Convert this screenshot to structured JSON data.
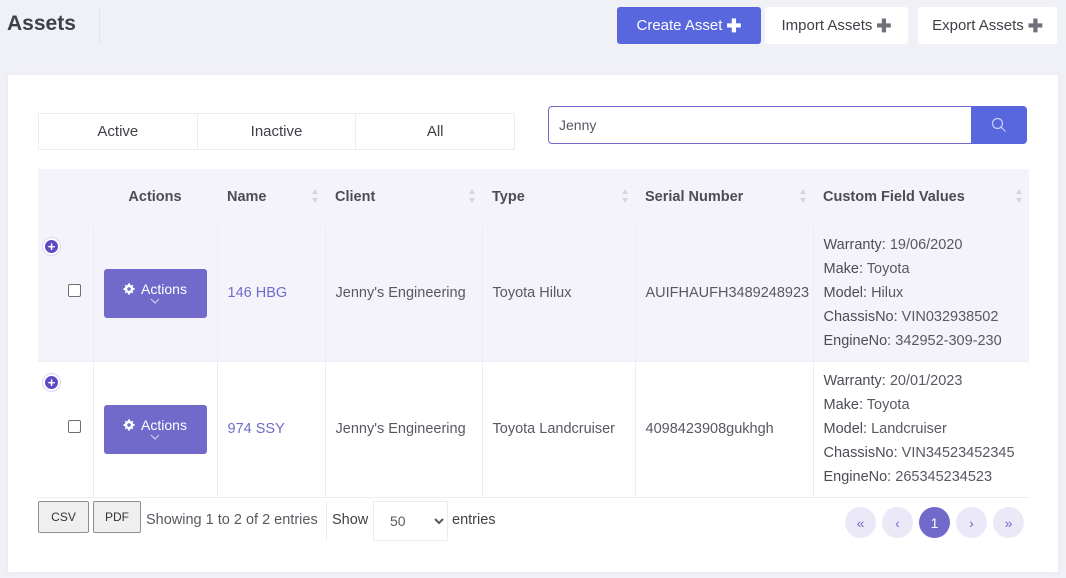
{
  "header": {
    "title": "Assets",
    "buttons": {
      "create": "Create Asset",
      "import": "Import Assets",
      "export": "Export Assets"
    }
  },
  "filters": {
    "tabs": [
      {
        "label": "Active"
      },
      {
        "label": "Inactive"
      },
      {
        "label": "All"
      }
    ]
  },
  "search": {
    "value": "Jenny",
    "icon": "search-icon"
  },
  "table": {
    "columns": [
      "",
      "Actions",
      "Name",
      "Client",
      "Type",
      "Serial Number",
      "Custom Field Values"
    ],
    "actions_label": "Actions",
    "rows": [
      {
        "name": "146 HBG",
        "client": "Jenny's Engineering",
        "type": "Toyota Hilux",
        "serial": "AUIFHAUFH3489248923",
        "custom_fields": [
          {
            "label": "Warranty:",
            "value": "19/06/2020"
          },
          {
            "label": "Make:",
            "value": "Toyota"
          },
          {
            "label": "Model:",
            "value": "Hilux"
          },
          {
            "label": "ChassisNo:",
            "value": "VIN032938502"
          },
          {
            "label": "EngineNo:",
            "value": "342952-309-230"
          }
        ]
      },
      {
        "name": "974 SSY",
        "client": "Jenny's Engineering",
        "type": "Toyota Landcruiser",
        "serial": "4098423908gukhgh",
        "custom_fields": [
          {
            "label": "Warranty:",
            "value": "20/01/2023"
          },
          {
            "label": "Make:",
            "value": "Toyota"
          },
          {
            "label": "Model:",
            "value": "Landcruiser"
          },
          {
            "label": "ChassisNo:",
            "value": "VIN34523452345"
          },
          {
            "label": "EngineNo:",
            "value": "265345234523"
          }
        ]
      }
    ]
  },
  "footer": {
    "csv": "CSV",
    "pdf": "PDF",
    "info": "Showing 1 to 2 of 2 entries",
    "show": "Show",
    "page_length": "50",
    "entries": "entries",
    "pagination": {
      "first": "«",
      "prev": "‹",
      "current": "1",
      "next": "›",
      "last": "»"
    }
  },
  "colors": {
    "primary": "#5867dd",
    "accent": "#716aca",
    "background": "#f0f1f7"
  }
}
